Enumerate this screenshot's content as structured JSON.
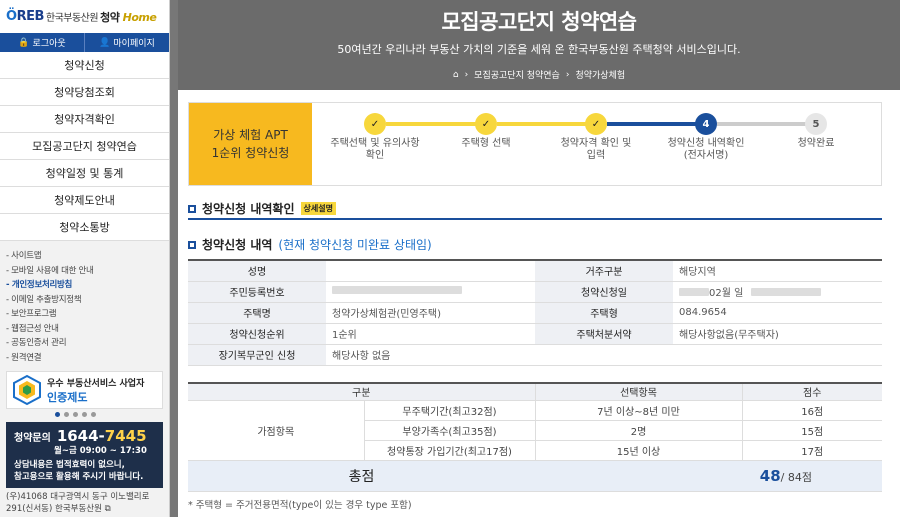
{
  "sidebar": {
    "logo": {
      "brand": "REB",
      "org": "한국부동산원",
      "product": "청약",
      "product_home": "Home"
    },
    "logout": "로그아웃",
    "mypage": "마이페이지",
    "menu": [
      "청약신청",
      "청약당첨조회",
      "청약자격확인",
      "모집공고단지 청약연습",
      "청약일정 및 통계",
      "청약제도안내",
      "청약소통방"
    ],
    "links": [
      "- 사이트맵",
      "- 모바일 사용에 대한 안내",
      "- 개인정보처리방침",
      "- 이메일 추출방지정책",
      "- 보안프로그램",
      "- 웹접근성 안내",
      "- 공동인증서 관리",
      "- 원격연결"
    ],
    "cert": {
      "line1": "우수 부동산서비스 사업자",
      "line2": "인증제도"
    },
    "call": {
      "label": "청약문의",
      "num_a": "1644-",
      "num_b": "7445",
      "hours": "월~금 09:00 ~ 17:30",
      "note1": "상담내용은 법적효력이 없으니,",
      "note2": "참고용으로 활용해 주시기 바랍니다."
    },
    "address1": "(우)41068 대구광역시 동구 이노밸리로",
    "address2": "291(신서동) 한국부동산원"
  },
  "banner": {
    "title": "모집공고단지 청약연습",
    "subtitle": "50여년간 우리나라 부동산 가치의 기준을 세워 온 한국부동산원 주택청약 서비스입니다.",
    "crumb": [
      "모집공고단지 청약연습",
      "청약가상체험"
    ]
  },
  "steps": {
    "label1": "가상 체험 APT",
    "label2": "1순위 청약신청",
    "items": [
      {
        "num": "✓",
        "line1": "주택선택 및 유의사항",
        "line2": "확인",
        "state": "done"
      },
      {
        "num": "✓",
        "line1": "주택형 선택",
        "line2": "",
        "state": "done"
      },
      {
        "num": "✓",
        "line1": "청약자격 확인 및",
        "line2": "입력",
        "state": "done"
      },
      {
        "num": "4",
        "line1": "청약신청 내역확인",
        "line2": "(전자서명)",
        "state": "current"
      },
      {
        "num": "5",
        "line1": "청약완료",
        "line2": "",
        "state": "todo"
      }
    ]
  },
  "section1": {
    "title": "청약신청 내역확인",
    "badge": "상세설명"
  },
  "section2": {
    "title": "청약신청 내역",
    "sub": "(현재 청약신청 미완료 상태임)"
  },
  "info": {
    "name_label": "성명",
    "name_value": "",
    "residence_label": "거주구분",
    "residence_value": "해당지역",
    "rrn_label": "주민등록번호",
    "rrn_value": "",
    "date_label": "청약신청일",
    "date_value": "02월 일",
    "house_label": "주택명",
    "house_value": "청약가상체험관(민영주택)",
    "type_label": "주택형",
    "type_value": "084.9654",
    "rank_label": "청약신청순위",
    "rank_value": "1순위",
    "disposal_label": "주택처분서약",
    "disposal_value": "해당사항없음(무주택자)",
    "military_label": "장기복무군인 신청",
    "military_value": "해당사항 없음"
  },
  "score": {
    "headers": [
      "구분",
      "선택항목",
      "점수"
    ],
    "group": "가점항목",
    "rows": [
      {
        "item": "무주택기간(최고32점)",
        "choice": "7년 이상~8년 미만",
        "points": "16점"
      },
      {
        "item": "부양가족수(최고35점)",
        "choice": "2명",
        "points": "15점"
      },
      {
        "item": "청약통장 가입기간(최고17점)",
        "choice": "15년 이상",
        "points": "17점"
      }
    ],
    "total_label": "총점",
    "total_value": "48",
    "total_max": "/ 84점"
  },
  "footnote": "* 주택형 = 주거전용면적(type이 있는 경우 type 포함)"
}
